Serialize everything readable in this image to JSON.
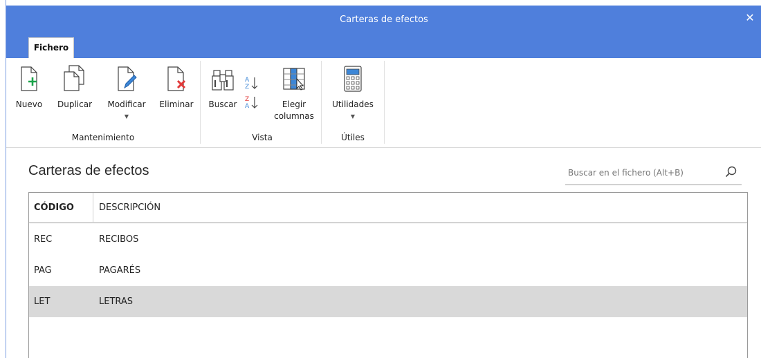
{
  "window": {
    "title": "Carteras de efectos",
    "close_glyph": "✕"
  },
  "tabs": [
    {
      "label": "Fichero",
      "active": true
    }
  ],
  "ribbon": {
    "groups": [
      {
        "label": "Mantenimiento",
        "buttons": [
          {
            "label": "Nuevo",
            "icon": "new-document-icon"
          },
          {
            "label": "Duplicar",
            "icon": "duplicate-icon"
          },
          {
            "label": "Modificar",
            "icon": "edit-document-icon",
            "has_dropdown": true
          },
          {
            "label": "Eliminar",
            "icon": "delete-document-icon"
          }
        ]
      },
      {
        "label": "Vista",
        "buttons": [
          {
            "label": "Buscar",
            "icon": "binoculars-icon"
          },
          {
            "label": "",
            "icon": "sort-ascending-icon"
          },
          {
            "label": "",
            "icon": "sort-descending-icon"
          },
          {
            "label": "Elegir",
            "label2": "columnas",
            "icon": "choose-columns-icon"
          }
        ]
      },
      {
        "label": "Útiles",
        "buttons": [
          {
            "label": "Utilidades",
            "icon": "calculator-icon",
            "has_dropdown": true
          }
        ]
      }
    ]
  },
  "main": {
    "title": "Carteras de efectos",
    "search": {
      "placeholder": "Buscar en el fichero (Alt+B)",
      "value": ""
    },
    "table": {
      "columns": [
        "CÓDIGO",
        "DESCRIPCIÓN"
      ],
      "rows": [
        {
          "code": "REC",
          "description": "RECIBOS",
          "selected": false
        },
        {
          "code": "PAG",
          "description": "PAGARÉS",
          "selected": false
        },
        {
          "code": "LET",
          "description": "LETRAS",
          "selected": true
        }
      ]
    }
  },
  "colors": {
    "titlebar": "#4f7fdc",
    "accent_green": "#1aa34a",
    "delete_red": "#e23a3a",
    "selected_row": "#d9d9d9"
  }
}
